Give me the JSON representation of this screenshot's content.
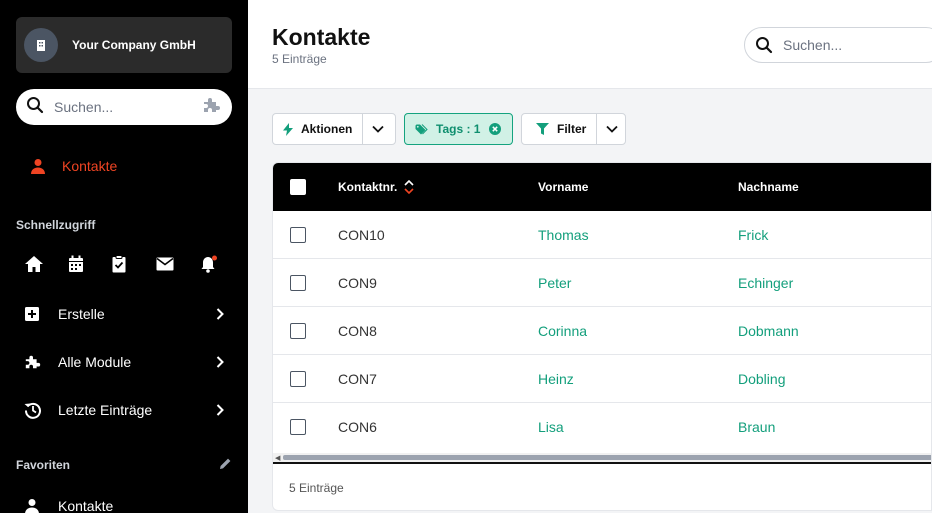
{
  "sidebar": {
    "company_name": "Your Company GmbH",
    "search_placeholder": "Suchen...",
    "active_item": "Kontakte",
    "quick_access_label": "Schnellzugriff",
    "quick_icons": [
      "home-icon",
      "calendar-icon",
      "clipboard-check-icon",
      "mail-icon",
      "bell-icon"
    ],
    "items": [
      {
        "label": "Erstelle",
        "icon": "plus-square-icon"
      },
      {
        "label": "Alle Module",
        "icon": "puzzle-icon"
      },
      {
        "label": "Letzte Einträge",
        "icon": "history-icon"
      }
    ],
    "favorites_label": "Favoriten",
    "favorites": [
      {
        "label": "Kontakte",
        "icon": "person-icon"
      }
    ]
  },
  "header": {
    "title": "Kontakte",
    "count": "5 Einträge",
    "search_placeholder": "Suchen..."
  },
  "toolbar": {
    "actions_label": "Aktionen",
    "tags_label": "Tags : 1",
    "filter_label": "Filter"
  },
  "table": {
    "columns": [
      "Kontaktnr.",
      "Vorname",
      "Nachname"
    ],
    "rows": [
      {
        "id": "CON10",
        "first": "Thomas",
        "last": "Frick"
      },
      {
        "id": "CON9",
        "first": "Peter",
        "last": "Echinger"
      },
      {
        "id": "CON8",
        "first": "Corinna",
        "last": "Dobmann"
      },
      {
        "id": "CON7",
        "first": "Heinz",
        "last": "Dobling"
      },
      {
        "id": "CON6",
        "first": "Lisa",
        "last": "Braun"
      }
    ],
    "footer": "5 Einträge"
  },
  "colors": {
    "accent_red": "#ef4423",
    "accent_green": "#139f7c",
    "sidebar_bg": "#000000"
  }
}
